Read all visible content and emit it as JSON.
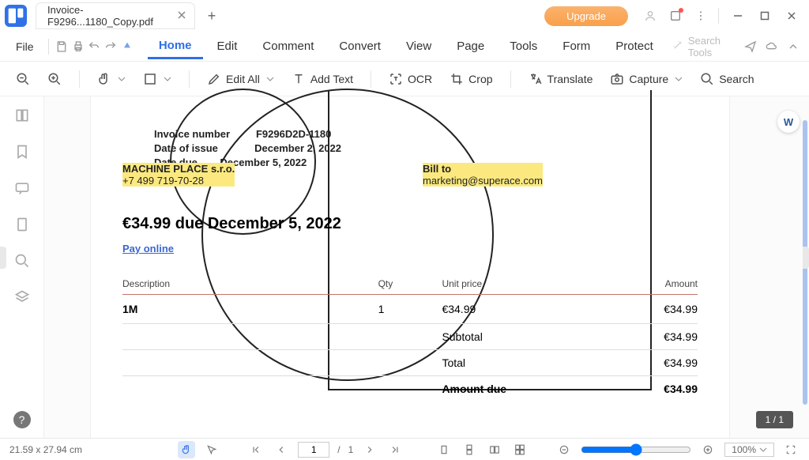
{
  "app": {
    "tab_title": "Invoice-F9296...1180_Copy.pdf"
  },
  "titlebar": {
    "upgrade": "Upgrade"
  },
  "menubar": {
    "file": "File",
    "items": [
      "Home",
      "Edit",
      "Comment",
      "Convert",
      "View",
      "Page",
      "Tools",
      "Form",
      "Protect"
    ],
    "search_placeholder": "Search Tools"
  },
  "toolbar": {
    "edit_all": "Edit All",
    "add_text": "Add Text",
    "ocr": "OCR",
    "crop": "Crop",
    "translate": "Translate",
    "capture": "Capture",
    "search": "Search"
  },
  "document": {
    "meta": {
      "invoice_number_label": "Invoice number",
      "invoice_number": "F9296D2D-1180",
      "date_of_issue_label": "Date of issue",
      "date_of_issue": "December 2, 2022",
      "date_due_label": "Date due",
      "date_due": "December 5, 2022"
    },
    "from": {
      "name": "MACHINE PLACE s.r.o.",
      "phone": "+7 499 719-70-28"
    },
    "billto": {
      "label": "Bill to",
      "email": "marketing@superace.com"
    },
    "due_line": "€34.99 due December 5, 2022",
    "pay_online": "Pay online",
    "table": {
      "headers": {
        "description": "Description",
        "qty": "Qty",
        "unit_price": "Unit price",
        "amount": "Amount"
      },
      "rows": [
        {
          "description": "1M",
          "qty": "1",
          "unit_price": "€34.99",
          "amount": "€34.99"
        }
      ],
      "subtotal_label": "Subtotal",
      "subtotal": "€34.99",
      "total_label": "Total",
      "total": "€34.99",
      "amount_due_label": "Amount due",
      "amount_due": "€34.99"
    }
  },
  "footer": {
    "dimensions": "21.59 x 27.94 cm",
    "page_current": "1",
    "page_sep": "/",
    "page_total": "1",
    "zoom": "100%"
  },
  "page_indicator": "1 / 1"
}
